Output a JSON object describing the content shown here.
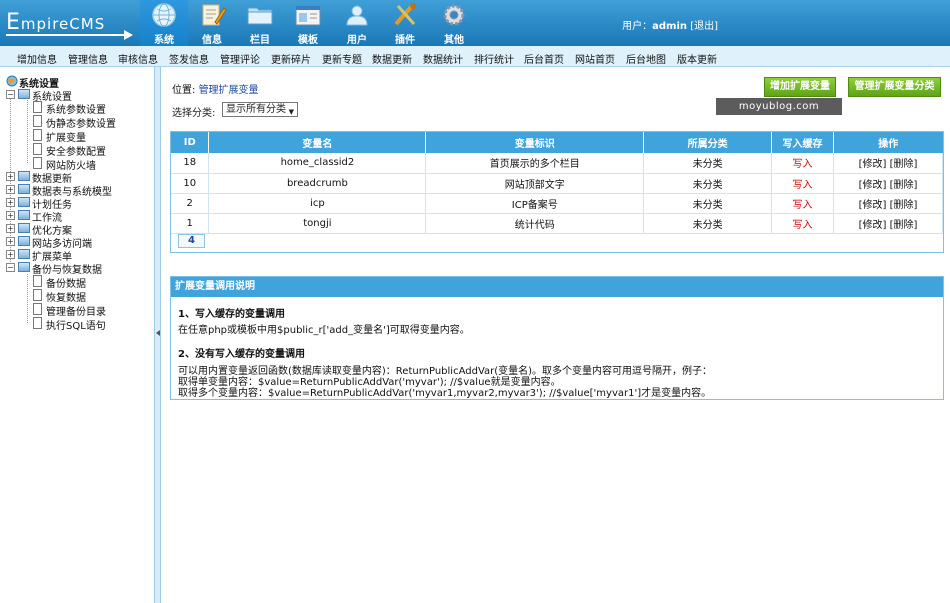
{
  "logo": {
    "text_first": "E",
    "text_rest": "mpireCMS"
  },
  "nav": [
    {
      "label": "系统",
      "icon": "globe-icon",
      "active": true
    },
    {
      "label": "信息",
      "icon": "edit-doc-icon"
    },
    {
      "label": "栏目",
      "icon": "folder-icon"
    },
    {
      "label": "模板",
      "icon": "window-icon"
    },
    {
      "label": "用户",
      "icon": "user-icon"
    },
    {
      "label": "插件",
      "icon": "tools-icon"
    },
    {
      "label": "其他",
      "icon": "gear-icon"
    }
  ],
  "user": {
    "prefix": "用户：",
    "name": "admin",
    "logout": "[退出]"
  },
  "menubar": [
    "增加信息",
    "管理信息",
    "审核信息",
    "签发信息",
    "管理评论",
    "更新碎片",
    "更新专题",
    "数据更新",
    "数据统计",
    "排行统计",
    "后台首页",
    "网站首页",
    "后台地图",
    "版本更新"
  ],
  "sidebar": {
    "root": "系统设置",
    "items": [
      {
        "label": "系统设置",
        "type": "folder",
        "expanded": true
      },
      {
        "label": "系统参数设置",
        "type": "doc"
      },
      {
        "label": "伪静态参数设置",
        "type": "doc"
      },
      {
        "label": "扩展变量",
        "type": "doc"
      },
      {
        "label": "安全参数配置",
        "type": "doc"
      },
      {
        "label": "网站防火墙",
        "type": "doc"
      },
      {
        "label": "数据更新",
        "type": "folder"
      },
      {
        "label": "数据表与系统模型",
        "type": "folder"
      },
      {
        "label": "计划任务",
        "type": "folder"
      },
      {
        "label": "工作流",
        "type": "folder"
      },
      {
        "label": "优化方案",
        "type": "folder"
      },
      {
        "label": "网站多访问端",
        "type": "folder"
      },
      {
        "label": "扩展菜单",
        "type": "folder"
      },
      {
        "label": "备份与恢复数据",
        "type": "folder",
        "expanded": true
      },
      {
        "label": "备份数据",
        "type": "doc"
      },
      {
        "label": "恢复数据",
        "type": "doc"
      },
      {
        "label": "管理备份目录",
        "type": "doc"
      },
      {
        "label": "执行SQL语句",
        "type": "doc"
      }
    ]
  },
  "breadcrumb": {
    "prefix": "位置: ",
    "link": "管理扩展变量"
  },
  "buttons": {
    "add": "增加扩展变量",
    "manage_class": "管理扩展变量分类"
  },
  "watermark": "moyublog.com",
  "filter": {
    "label": "选择分类:",
    "value": "显示所有分类"
  },
  "table": {
    "headers": [
      "ID",
      "变量名",
      "变量标识",
      "所属分类",
      "写入缓存",
      "操作"
    ],
    "rows": [
      {
        "id": "18",
        "name": "home_classid2",
        "desc": "首页展示的多个栏目",
        "cat": "未分类",
        "cache": "写入",
        "ops": "[修改] [删除]"
      },
      {
        "id": "10",
        "name": "breadcrumb",
        "desc": "网站顶部文字",
        "cat": "未分类",
        "cache": "写入",
        "ops": "[修改] [删除]"
      },
      {
        "id": "2",
        "name": "icp",
        "desc": "ICP备案号",
        "cat": "未分类",
        "cache": "写入",
        "ops": "[修改] [删除]"
      },
      {
        "id": "1",
        "name": "tongji",
        "desc": "统计代码",
        "cat": "未分类",
        "cache": "写入",
        "ops": "[修改] [删除]"
      }
    ],
    "page": "4"
  },
  "help": {
    "title": "扩展变量调用说明",
    "s1_title": "1、写入缓存的变量调用",
    "s1_text": "在任意php或模板中用$public_r['add_变量名']可取得变量内容。",
    "s2_title": "2、没有写入缓存的变量调用",
    "s2_l1": "可以用内置变量返回函数(数据库读取变量内容)：ReturnPublicAddVar(变量名)。取多个变量内容可用逗号隔开，例子：",
    "s2_l2": "取得单变量内容：$value=ReturnPublicAddVar('myvar'); //$value就是变量内容。",
    "s2_l3": "取得多个变量内容：$value=ReturnPublicAddVar('myvar1,myvar2,myvar3'); //$value['myvar1']才是变量内容。"
  }
}
